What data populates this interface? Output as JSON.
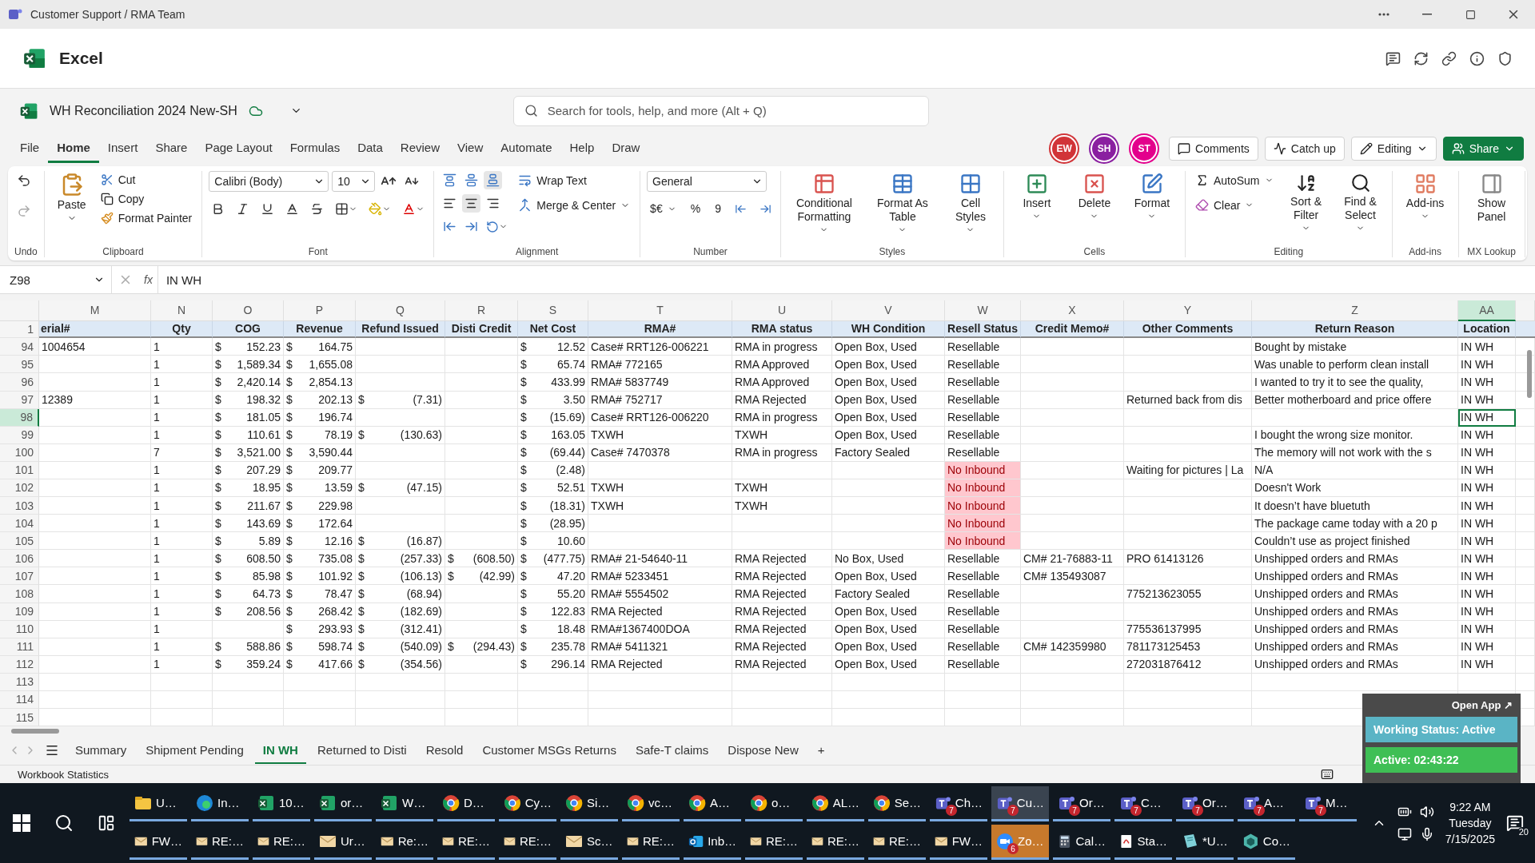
{
  "window": {
    "title": "Customer Support / RMA Team"
  },
  "app": {
    "name": "Excel"
  },
  "document": {
    "title": "WH Reconciliation 2024 New-SH"
  },
  "search": {
    "placeholder": "Search for tools, help, and more (Alt + Q)"
  },
  "menu_tabs": [
    {
      "label": "File",
      "selected": false
    },
    {
      "label": "Home",
      "selected": true
    },
    {
      "label": "Insert",
      "selected": false
    },
    {
      "label": "Share",
      "selected": false
    },
    {
      "label": "Page Layout",
      "selected": false
    },
    {
      "label": "Formulas",
      "selected": false
    },
    {
      "label": "Data",
      "selected": false
    },
    {
      "label": "Review",
      "selected": false
    },
    {
      "label": "View",
      "selected": false
    },
    {
      "label": "Automate",
      "selected": false
    },
    {
      "label": "Help",
      "selected": false
    },
    {
      "label": "Draw",
      "selected": false
    }
  ],
  "collaborators": [
    {
      "initials": "EW",
      "color": "#d13438"
    },
    {
      "initials": "SH",
      "color": "#8a1fa0"
    },
    {
      "initials": "ST",
      "color": "#e3008c"
    }
  ],
  "actions": [
    {
      "label": "Comments",
      "kind": "comments"
    },
    {
      "label": "Catch up",
      "kind": "catchup"
    },
    {
      "label": "Editing",
      "kind": "editing"
    },
    {
      "label": "Share",
      "kind": "share"
    }
  ],
  "ribbon": {
    "groups": [
      {
        "label": "Undo",
        "kind": "undo"
      },
      {
        "label": "Clipboard",
        "kind": "clipboard",
        "paste": "Paste",
        "items": [
          "Cut",
          "Copy",
          "Format Painter"
        ]
      },
      {
        "label": "Font",
        "kind": "font",
        "font": "Calibri (Body)",
        "size": "10"
      },
      {
        "label": "Alignment",
        "kind": "alignment",
        "items": [
          "Wrap Text",
          "Merge & Center"
        ]
      },
      {
        "label": "Number",
        "kind": "number",
        "format": "General",
        "currency": "$€",
        "percent": "%",
        "comma": "9"
      },
      {
        "label": "Styles",
        "kind": "big",
        "items": [
          "Conditional Formatting",
          "Format As Table",
          "Cell Styles"
        ]
      },
      {
        "label": "Cells",
        "kind": "big",
        "items": [
          "Insert",
          "Delete",
          "Format"
        ]
      },
      {
        "label": "Editing",
        "kind": "editing",
        "items": [
          "AutoSum",
          "Clear"
        ],
        "buttons": [
          "Sort & Filter",
          "Find & Select"
        ]
      },
      {
        "label": "Add-ins",
        "kind": "big",
        "items": [
          "Add-ins"
        ]
      },
      {
        "label": "MX Lookup",
        "kind": "big",
        "items": [
          "Show Panel"
        ]
      }
    ]
  },
  "formula_bar": {
    "name_box": "Z98",
    "fx": "fx",
    "value": "IN WH"
  },
  "sheet": {
    "columns": [
      {
        "letter": "M",
        "selected": false
      },
      {
        "letter": "N",
        "selected": false
      },
      {
        "letter": "O",
        "selected": false
      },
      {
        "letter": "P",
        "selected": false
      },
      {
        "letter": "Q",
        "selected": false
      },
      {
        "letter": "R",
        "selected": false
      },
      {
        "letter": "S",
        "selected": false
      },
      {
        "letter": "T",
        "selected": false
      },
      {
        "letter": "U",
        "selected": false
      },
      {
        "letter": "V",
        "selected": false
      },
      {
        "letter": "W",
        "selected": false
      },
      {
        "letter": "X",
        "selected": false
      },
      {
        "letter": "Y",
        "selected": false
      },
      {
        "letter": "Z",
        "selected": false
      },
      {
        "letter": "AA",
        "selected": true
      }
    ],
    "header_row": "1",
    "headers": [
      "erial#",
      "Qty",
      "COG",
      "Revenue",
      "Refund Issued",
      "Disti Credit",
      "Net Cost",
      "RMA#",
      "RMA status",
      "WH Condition",
      "Resell Status",
      "Credit Memo#",
      "Other Comments",
      "Return Reason",
      "Location"
    ],
    "rows": [
      {
        "num": "94",
        "selected": false,
        "cells": [
          "1004654",
          "1",
          [
            "$",
            "152.23"
          ],
          [
            "$",
            "164.75"
          ],
          null,
          null,
          [
            "$",
            "12.52"
          ],
          "Case# RRT126-006221",
          "RMA in progress",
          "Open Box, Used",
          "Resellable",
          null,
          null,
          "Bought by mistake",
          "IN WH"
        ]
      },
      {
        "num": "95",
        "selected": false,
        "cells": [
          null,
          "1",
          [
            "$",
            "1,589.34"
          ],
          [
            "$",
            "1,655.08"
          ],
          null,
          null,
          [
            "$",
            "65.74"
          ],
          "RMA# 772165",
          "RMA Approved",
          "Open Box, Used",
          "Resellable",
          null,
          null,
          "Was unable to perform clean install",
          "IN WH"
        ]
      },
      {
        "num": "96",
        "selected": false,
        "cells": [
          null,
          "1",
          [
            "$",
            "2,420.14"
          ],
          [
            "$",
            "2,854.13"
          ],
          null,
          null,
          [
            "$",
            "433.99"
          ],
          "RMA# 5837749",
          "RMA Approved",
          "Open Box, Used",
          "Resellable",
          null,
          null,
          "I wanted to try it to see the quality,",
          "IN WH"
        ]
      },
      {
        "num": "97",
        "selected": false,
        "cells": [
          "12389",
          "1",
          [
            "$",
            "198.32"
          ],
          [
            "$",
            "202.13"
          ],
          [
            "$",
            "(7.31)"
          ],
          null,
          [
            "$",
            "3.50"
          ],
          "RMA# 752717",
          "RMA Rejected",
          "Open Box, Used",
          "Resellable",
          null,
          "Returned back from dis",
          "Better motherboard and price offere",
          "IN WH"
        ]
      },
      {
        "num": "98",
        "selected": true,
        "cells": [
          null,
          "1",
          [
            "$",
            "181.05"
          ],
          [
            "$",
            "196.74"
          ],
          null,
          null,
          [
            "$",
            "(15.69)"
          ],
          "Case# RRT126-006220",
          "RMA in progress",
          "Open Box, Used",
          "Resellable",
          null,
          null,
          null,
          "IN WH"
        ]
      },
      {
        "num": "99",
        "selected": false,
        "cells": [
          null,
          "1",
          [
            "$",
            "110.61"
          ],
          [
            "$",
            "78.19"
          ],
          [
            "$",
            "(130.63)"
          ],
          null,
          [
            "$",
            "163.05"
          ],
          "TXWH",
          "TXWH",
          "Open Box, Used",
          "Resellable",
          null,
          null,
          "I bought the wrong size monitor.",
          "IN WH"
        ]
      },
      {
        "num": "100",
        "selected": false,
        "cells": [
          null,
          "7",
          [
            "$",
            "3,521.00"
          ],
          [
            "$",
            "3,590.44"
          ],
          null,
          null,
          [
            "$",
            "(69.44)"
          ],
          "Case# 7470378",
          "RMA in progress",
          "Factory Sealed",
          "Resellable",
          null,
          null,
          "The memory will not work with the s",
          "IN WH"
        ]
      },
      {
        "num": "101",
        "selected": false,
        "cells": [
          null,
          "1",
          [
            "$",
            "207.29"
          ],
          [
            "$",
            "209.77"
          ],
          null,
          null,
          [
            "$",
            "(2.48)"
          ],
          null,
          null,
          null,
          {
            "text": "No Inbound",
            "flagged": true
          },
          null,
          "Waiting for pictures | La",
          "N/A",
          "IN WH"
        ]
      },
      {
        "num": "102",
        "selected": false,
        "cells": [
          null,
          "1",
          [
            "$",
            "18.95"
          ],
          [
            "$",
            "13.59"
          ],
          [
            "$",
            "(47.15)"
          ],
          null,
          [
            "$",
            "52.51"
          ],
          "TXWH",
          "TXWH",
          null,
          {
            "text": "No Inbound",
            "flagged": true
          },
          null,
          null,
          "Doesn't Work",
          "IN WH"
        ]
      },
      {
        "num": "103",
        "selected": false,
        "cells": [
          null,
          "1",
          [
            "$",
            "211.67"
          ],
          [
            "$",
            "229.98"
          ],
          null,
          null,
          [
            "$",
            "(18.31)"
          ],
          "TXWH",
          "TXWH",
          null,
          {
            "text": "No Inbound",
            "flagged": true
          },
          null,
          null,
          "It doesn’t have bluetuth",
          "IN WH"
        ]
      },
      {
        "num": "104",
        "selected": false,
        "cells": [
          null,
          "1",
          [
            "$",
            "143.69"
          ],
          [
            "$",
            "172.64"
          ],
          null,
          null,
          [
            "$",
            "(28.95)"
          ],
          null,
          null,
          null,
          {
            "text": "No Inbound",
            "flagged": true
          },
          null,
          null,
          "The package came today with a 20 p",
          "IN WH"
        ]
      },
      {
        "num": "105",
        "selected": false,
        "cells": [
          null,
          "1",
          [
            "$",
            "5.89"
          ],
          [
            "$",
            "12.16"
          ],
          [
            "$",
            "(16.87)"
          ],
          null,
          [
            "$",
            "10.60"
          ],
          null,
          null,
          null,
          {
            "text": "No Inbound",
            "flagged": true
          },
          null,
          null,
          "Couldn’t use as project finished",
          "IN WH"
        ]
      },
      {
        "num": "106",
        "selected": false,
        "cells": [
          null,
          "1",
          [
            "$",
            "608.50"
          ],
          [
            "$",
            "735.08"
          ],
          [
            "$",
            "(257.33)"
          ],
          [
            "$",
            "(608.50)"
          ],
          [
            "$",
            "(477.75)"
          ],
          "RMA# 21-54640-11",
          "RMA Rejected",
          "No Box, Used",
          "Resellable",
          "CM# 21-76883-11",
          "PRO 61413126",
          "Unshipped orders and RMAs",
          "IN WH"
        ]
      },
      {
        "num": "107",
        "selected": false,
        "cells": [
          null,
          "1",
          [
            "$",
            "85.98"
          ],
          [
            "$",
            "101.92"
          ],
          [
            "$",
            "(106.13)"
          ],
          [
            "$",
            "(42.99)"
          ],
          [
            "$",
            "47.20"
          ],
          "RMA# 5233451",
          "RMA Rejected",
          "Open Box, Used",
          "Resellable",
          "CM# 135493087",
          null,
          "Unshipped orders and RMAs",
          "IN WH"
        ]
      },
      {
        "num": "108",
        "selected": false,
        "cells": [
          null,
          "1",
          [
            "$",
            "64.73"
          ],
          [
            "$",
            "78.47"
          ],
          [
            "$",
            "(68.94)"
          ],
          null,
          [
            "$",
            "55.20"
          ],
          "RMA# 5554502",
          "RMA Rejected",
          "Factory Sealed",
          "Resellable",
          null,
          "775213623055",
          "Unshipped orders and RMAs",
          "IN WH"
        ]
      },
      {
        "num": "109",
        "selected": false,
        "cells": [
          null,
          "1",
          [
            "$",
            "208.56"
          ],
          [
            "$",
            "268.42"
          ],
          [
            "$",
            "(182.69)"
          ],
          null,
          [
            "$",
            "122.83"
          ],
          "RMA Rejected",
          "RMA Rejected",
          "Open Box, Used",
          "Resellable",
          null,
          null,
          "Unshipped orders and RMAs",
          "IN WH"
        ]
      },
      {
        "num": "110",
        "selected": false,
        "cells": [
          null,
          "1",
          null,
          [
            "$",
            "293.93"
          ],
          [
            "$",
            "(312.41)"
          ],
          null,
          [
            "$",
            "18.48"
          ],
          "RMA#1367400DOA",
          "RMA Rejected",
          "Open Box, Used",
          "Resellable",
          null,
          "775536137995",
          "Unshipped orders and RMAs",
          "IN WH"
        ]
      },
      {
        "num": "111",
        "selected": false,
        "cells": [
          null,
          "1",
          [
            "$",
            "588.86"
          ],
          [
            "$",
            "598.74"
          ],
          [
            "$",
            "(540.09)"
          ],
          [
            "$",
            "(294.43)"
          ],
          [
            "$",
            "235.78"
          ],
          "RMA# 5411321",
          "RMA Rejected",
          "Open Box, Used",
          "Resellable",
          "CM# 142359980",
          "781173125453",
          "Unshipped orders and RMAs",
          "IN WH"
        ]
      },
      {
        "num": "112",
        "selected": false,
        "cells": [
          null,
          "1",
          [
            "$",
            "359.24"
          ],
          [
            "$",
            "417.66"
          ],
          [
            "$",
            "(354.56)"
          ],
          null,
          [
            "$",
            "296.14"
          ],
          "RMA Rejected",
          "RMA Rejected",
          "Open Box, Used",
          "Resellable",
          null,
          "272031876412",
          "Unshipped orders and RMAs",
          "IN WH"
        ]
      },
      {
        "num": "113",
        "selected": false
      },
      {
        "num": "114",
        "selected": false
      },
      {
        "num": "115",
        "selected": false
      }
    ]
  },
  "sheet_tabs": [
    {
      "label": "Summary",
      "selected": false
    },
    {
      "label": "Shipment Pending",
      "selected": false
    },
    {
      "label": "IN WH",
      "selected": true
    },
    {
      "label": "Returned to Disti",
      "selected": false
    },
    {
      "label": "Resold",
      "selected": false
    },
    {
      "label": "Customer MSGs Returns",
      "selected": false
    },
    {
      "label": "Safe-T claims",
      "selected": false
    },
    {
      "label": "Dispose New",
      "selected": false
    }
  ],
  "add_sheet": "+",
  "status_bar": {
    "text": "Workbook Statistics"
  },
  "tracker": {
    "open": "Open App ↗",
    "status": "Working Status: Active",
    "timer": "Active: 02:43:22"
  },
  "taskbar": {
    "top": [
      {
        "label": "U…",
        "kind": "folder",
        "active": false
      },
      {
        "label": "In…",
        "kind": "edge",
        "active": false
      },
      {
        "label": "10…",
        "kind": "excel",
        "active": false
      },
      {
        "label": "or…",
        "kind": "excel",
        "active": false
      },
      {
        "label": "W…",
        "kind": "excel",
        "active": false
      },
      {
        "label": "D…",
        "kind": "chrome",
        "active": false
      },
      {
        "label": "Cy…",
        "kind": "chrome",
        "active": false
      },
      {
        "label": "Si…",
        "kind": "chrome",
        "active": false
      },
      {
        "label": "vc…",
        "kind": "chrome",
        "active": false
      },
      {
        "label": "A…",
        "kind": "chrome",
        "active": false
      },
      {
        "label": "o…",
        "kind": "chrome",
        "active": false
      },
      {
        "label": "AL…",
        "kind": "chrome",
        "active": false
      },
      {
        "label": "Se…",
        "kind": "chrome",
        "active": false
      },
      {
        "label": "Ch…",
        "kind": "teams",
        "badge": "7",
        "active": false
      },
      {
        "label": "Cu…",
        "kind": "teams",
        "badge": "7",
        "active": true
      },
      {
        "label": "Or…",
        "kind": "teams",
        "badge": "7",
        "active": false
      },
      {
        "label": "C…",
        "kind": "teams",
        "badge": "7",
        "active": false
      },
      {
        "label": "Or…",
        "kind": "teams",
        "badge": "7",
        "active": false
      },
      {
        "label": "A…",
        "kind": "teams",
        "badge": "7",
        "active": false
      },
      {
        "label": "M…",
        "kind": "teams",
        "badge": "7",
        "active": false
      }
    ],
    "bottom": [
      {
        "label": "FW…",
        "kind": "mail",
        "active": false
      },
      {
        "label": "RE:…",
        "kind": "mail",
        "active": false
      },
      {
        "label": "RE:…",
        "kind": "mail",
        "active": false
      },
      {
        "label": "Ur…",
        "kind": "mail",
        "active": false
      },
      {
        "label": "Re:…",
        "kind": "mail",
        "active": false
      },
      {
        "label": "RE:…",
        "kind": "mail",
        "active": false
      },
      {
        "label": "RE:…",
        "kind": "mail",
        "active": false
      },
      {
        "label": "Sc…",
        "kind": "mail",
        "active": false
      },
      {
        "label": "RE:…",
        "kind": "mail",
        "active": false
      },
      {
        "label": "Inb…",
        "kind": "outlook",
        "active": false
      },
      {
        "label": "RE:…",
        "kind": "mail",
        "active": false
      },
      {
        "label": "RE:…",
        "kind": "mail",
        "active": false
      },
      {
        "label": "RE:…",
        "kind": "mail",
        "active": false
      },
      {
        "label": "FW…",
        "kind": "mail",
        "active": false
      },
      {
        "label": "Zo…",
        "kind": "zoom",
        "badge": "6",
        "active": true
      },
      {
        "label": "Cal…",
        "kind": "calculator",
        "active": false
      },
      {
        "label": "Sta…",
        "kind": "pdf",
        "active": false
      },
      {
        "label": "*U…",
        "kind": "notes",
        "active": false
      },
      {
        "label": "Co…",
        "kind": "hex",
        "active": false
      }
    ],
    "clock": {
      "time": "9:22 AM",
      "day": "Tuesday",
      "date": "7/15/2025"
    },
    "notifications": "20"
  }
}
